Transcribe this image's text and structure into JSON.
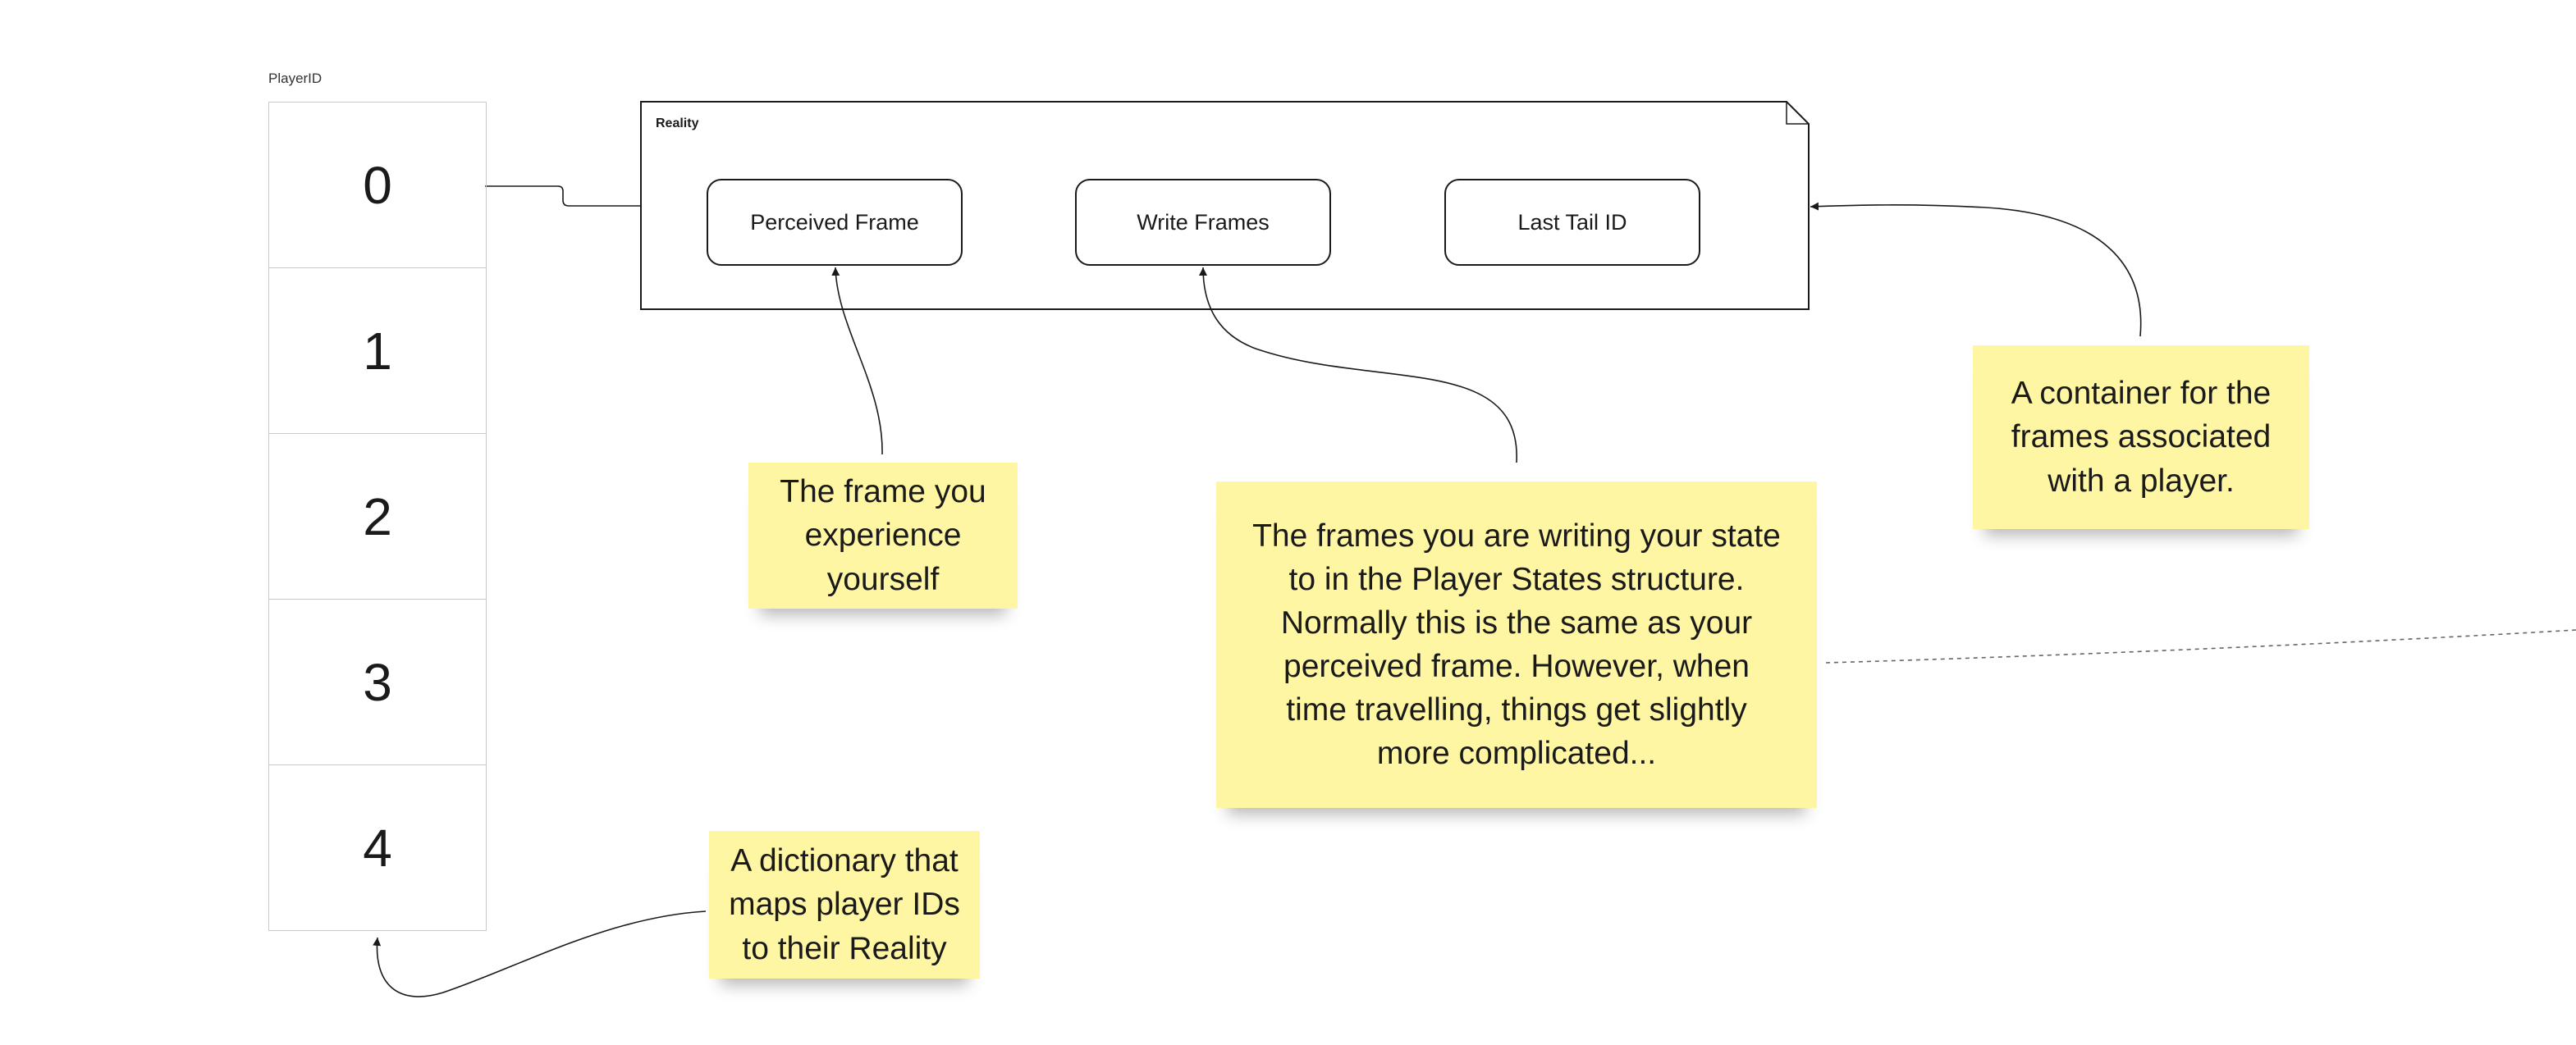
{
  "player_table": {
    "label": "PlayerID",
    "ids": [
      "0",
      "1",
      "2",
      "3",
      "4"
    ]
  },
  "reality": {
    "label": "Reality",
    "fields": [
      "Perceived Frame",
      "Write Frames",
      "Last Tail ID"
    ]
  },
  "notes": {
    "perceived_frame": "The frame you experience yourself",
    "write_frames": "The frames you are writing your state to in the Player States structure. Normally this is the same as your perceived frame. However, when time travelling, things get slightly more complicated...",
    "container": "A container for the frames associated with a player.",
    "dictionary": "A dictionary that maps player IDs to their Reality"
  },
  "colors": {
    "sticky_note": "#fff6a3",
    "stroke": "#1a1a1a",
    "table_border": "#c9c9c9"
  }
}
